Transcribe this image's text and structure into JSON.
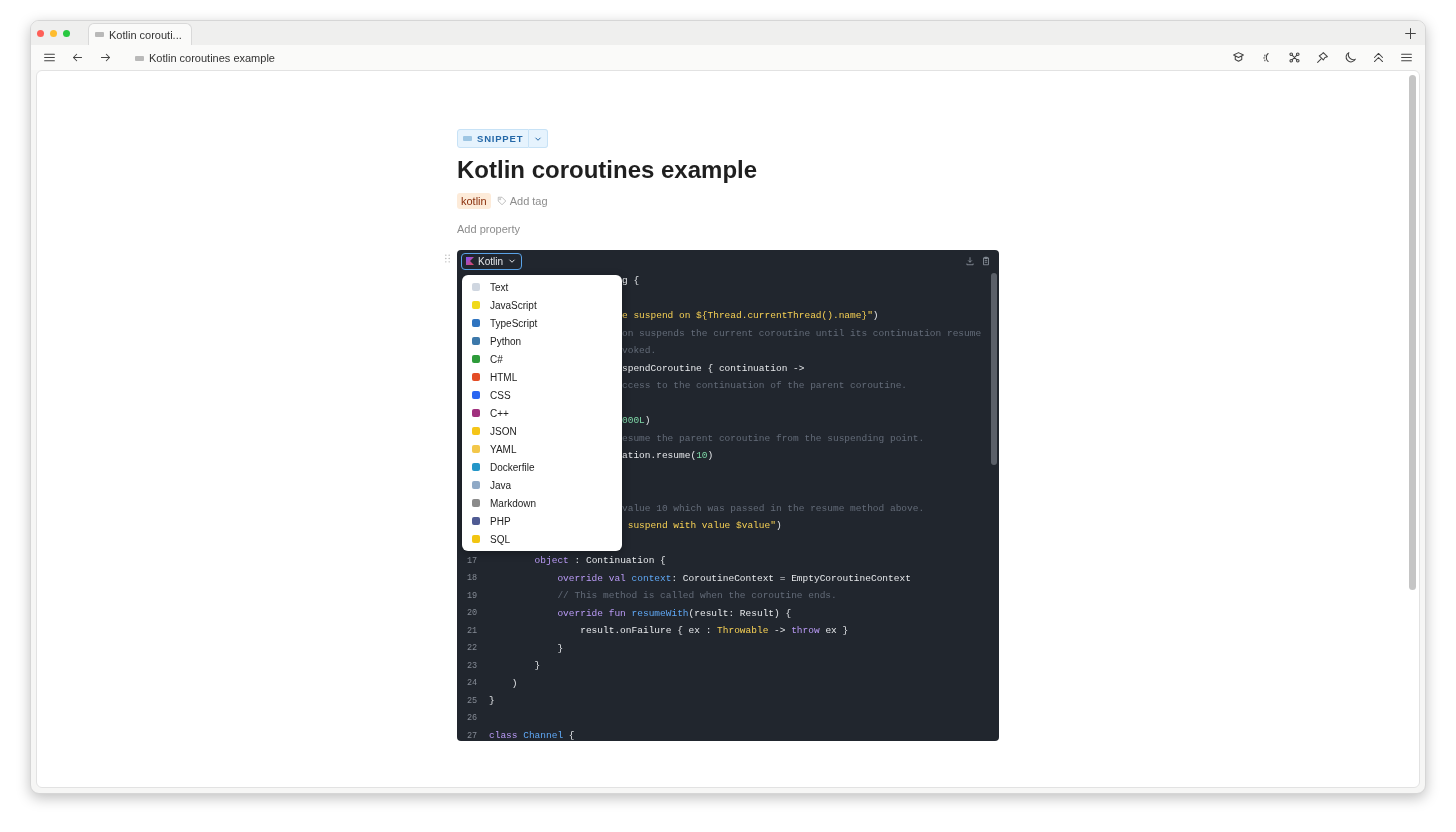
{
  "browser": {
    "tab": {
      "title": "Kotlin corouti...",
      "selected": true
    },
    "breadcrumb": "Kotlin coroutines example"
  },
  "note": {
    "type_badge": "SNIPPET",
    "title": "Kotlin coroutines example",
    "tags": [
      {
        "label": "kotlin",
        "color": "#fdebd9"
      }
    ],
    "add_tag": "Add tag",
    "add_property": "Add property"
  },
  "code_block": {
    "language": "Kotlin",
    "language_menu": [
      {
        "label": "Text",
        "color": "#cfd6e0"
      },
      {
        "label": "JavaScript",
        "color": "#f0d91a"
      },
      {
        "label": "TypeScript",
        "color": "#2f74c0"
      },
      {
        "label": "Python",
        "color": "#3c78aa"
      },
      {
        "label": "C#",
        "color": "#2e9b3a"
      },
      {
        "label": "HTML",
        "color": "#e44d26"
      },
      {
        "label": "CSS",
        "color": "#2965f1"
      },
      {
        "label": "C++",
        "color": "#a0307e"
      },
      {
        "label": "JSON",
        "color": "#f5c518"
      },
      {
        "label": "YAML",
        "color": "#f3c74a"
      },
      {
        "label": "Dockerfile",
        "color": "#2496c8"
      },
      {
        "label": "Java",
        "color": "#8fa9c6"
      },
      {
        "label": "Markdown",
        "color": "#8a8a8a"
      },
      {
        "label": "PHP",
        "color": "#4f5b93"
      },
      {
        "label": "SQL",
        "color": "#f2c511"
      }
    ],
    "lines": [
      {
        "tokens": [
          {
            "text": "g {",
            "kind": "plain"
          }
        ]
      },
      {
        "kind": "blank"
      },
      {
        "tokens": [
          {
            "text": "e suspend on ${Thread.currentThread().name}\"",
            "kind": "string"
          },
          {
            "text": ")",
            "kind": "plain"
          }
        ]
      },
      {
        "tokens": [
          {
            "text": "on suspends the current coroutine until its continuation resume",
            "kind": "comment"
          }
        ]
      },
      {
        "tokens": [
          {
            "text": "voked.",
            "kind": "comment"
          }
        ]
      },
      {
        "tokens": [
          {
            "text": "spendCoroutine { continuation ->",
            "kind": "plain"
          }
        ]
      },
      {
        "tokens": [
          {
            "text": "ccess to the continuation of the parent coroutine.",
            "kind": "comment"
          }
        ]
      },
      {
        "kind": "blank"
      },
      {
        "tokens": [
          {
            "text": "000L",
            "kind": "number"
          },
          {
            "text": ")",
            "kind": "plain"
          }
        ]
      },
      {
        "tokens": [
          {
            "text": "esume the parent coroutine from the suspending point.",
            "kind": "comment"
          }
        ]
      },
      {
        "tokens": [
          {
            "text": "ation.resume(",
            "kind": "plain"
          },
          {
            "text": "10",
            "kind": "number"
          },
          {
            "text": ")",
            "kind": "plain"
          }
        ]
      },
      {
        "kind": "blank"
      },
      {
        "kind": "blank"
      },
      {
        "tokens": [
          {
            "text": "value 10 which was passed in the resume method above.",
            "kind": "comment"
          }
        ]
      },
      {
        "tokens": [
          {
            "text": " suspend with value $value\"",
            "kind": "string"
          },
          {
            "text": ")",
            "kind": "plain"
          }
        ]
      },
      {
        "kind": "blank"
      },
      {
        "number": "17",
        "tokens": [
          {
            "text": "        object",
            "kind": "keyword"
          },
          {
            "text": " : Continuation {",
            "kind": "plain"
          }
        ]
      },
      {
        "number": "18",
        "tokens": [
          {
            "text": "            override val",
            "kind": "keyword"
          },
          {
            "text": " context",
            "kind": "function"
          },
          {
            "text": ": CoroutineContext = EmptyCoroutineContext",
            "kind": "plain"
          }
        ]
      },
      {
        "number": "19",
        "tokens": [
          {
            "text": "            // This method is called when the coroutine ends.",
            "kind": "comment"
          }
        ]
      },
      {
        "number": "20",
        "tokens": [
          {
            "text": "            override fun",
            "kind": "keyword"
          },
          {
            "text": " resumeWith",
            "kind": "function"
          },
          {
            "text": "(result: Result) {",
            "kind": "plain"
          }
        ]
      },
      {
        "number": "21",
        "tokens": [
          {
            "text": "                result.onFailure { ex : ",
            "kind": "plain"
          },
          {
            "text": "Throwable",
            "kind": "string"
          },
          {
            "text": " -> ",
            "kind": "plain"
          },
          {
            "text": "throw",
            "kind": "keyword"
          },
          {
            "text": " ex }",
            "kind": "plain"
          }
        ]
      },
      {
        "number": "22",
        "tokens": [
          {
            "text": "            }",
            "kind": "plain"
          }
        ]
      },
      {
        "number": "23",
        "tokens": [
          {
            "text": "        }",
            "kind": "plain"
          }
        ]
      },
      {
        "number": "24",
        "tokens": [
          {
            "text": "    )",
            "kind": "plain"
          }
        ]
      },
      {
        "number": "25",
        "tokens": [
          {
            "text": "}",
            "kind": "plain"
          }
        ]
      },
      {
        "number": "26"
      },
      {
        "number": "27",
        "tokens": [
          {
            "text": "class",
            "kind": "keyword"
          },
          {
            "text": " Channel",
            "kind": "function"
          },
          {
            "text": " {",
            "kind": "plain"
          }
        ]
      }
    ]
  }
}
